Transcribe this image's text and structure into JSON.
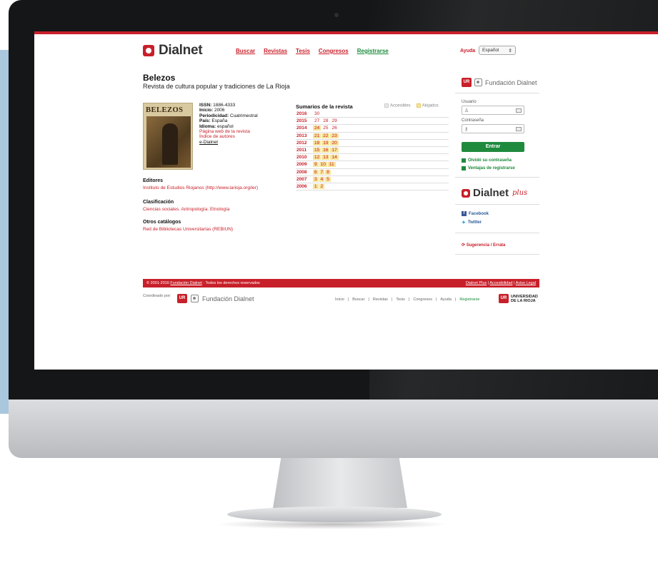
{
  "brand": {
    "name": "Dialnet",
    "accent": "#c8202a",
    "green": "#1f8a3c"
  },
  "nav": {
    "items": [
      "Buscar",
      "Revistas",
      "Tesis",
      "Congresos"
    ],
    "register": "Registrarse",
    "help": "Ayuda",
    "language": "Español"
  },
  "journal": {
    "title": "Belezos",
    "subtitle": "Revista de cultura popular y tradiciones de La Rioja",
    "cover_title": "BELEZOS",
    "issn_label": "ISSN:",
    "issn": "1886-4333",
    "inicio_label": "Inicio:",
    "inicio": "2006",
    "periodicidad_label": "Periodicidad:",
    "periodicidad": "Cuatrimestral",
    "pais_label": "País:",
    "pais": "España",
    "idioma_label": "Idioma:",
    "idioma": "español",
    "links": [
      "Página web de la revista",
      "Índice de autores",
      "e-Dialnet"
    ]
  },
  "sections": {
    "editores_title": "Editores",
    "editores": "Instituto de Estudios Riojanos (http://www.larioja.org/ier)",
    "clasificacion_title": "Clasificación",
    "clasificacion": "Ciencias sociales. Antropología. Etnología",
    "otros_title": "Otros catálogos",
    "otros": "Red de Bibliotecas Universitarias (REBIUN)"
  },
  "sumarios": {
    "title": "Sumarios de la revista",
    "legend_accesibles": "Accesibles",
    "legend_alojados": "Alojados",
    "rows": [
      {
        "year": "2016",
        "issues": [
          {
            "n": "30",
            "hosted": false
          }
        ]
      },
      {
        "year": "2015",
        "issues": [
          {
            "n": "27",
            "hosted": false
          },
          {
            "n": "28",
            "hosted": false
          },
          {
            "n": "29",
            "hosted": false
          }
        ]
      },
      {
        "year": "2014",
        "issues": [
          {
            "n": "24",
            "hosted": true
          },
          {
            "n": "25",
            "hosted": false
          },
          {
            "n": "26",
            "hosted": false
          }
        ]
      },
      {
        "year": "2013",
        "issues": [
          {
            "n": "21",
            "hosted": true
          },
          {
            "n": "22",
            "hosted": true
          },
          {
            "n": "23",
            "hosted": true
          }
        ]
      },
      {
        "year": "2012",
        "issues": [
          {
            "n": "18",
            "hosted": true
          },
          {
            "n": "19",
            "hosted": true
          },
          {
            "n": "20",
            "hosted": true
          }
        ]
      },
      {
        "year": "2011",
        "issues": [
          {
            "n": "15",
            "hosted": true
          },
          {
            "n": "16",
            "hosted": true
          },
          {
            "n": "17",
            "hosted": true
          }
        ]
      },
      {
        "year": "2010",
        "issues": [
          {
            "n": "12",
            "hosted": true
          },
          {
            "n": "13",
            "hosted": true
          },
          {
            "n": "14",
            "hosted": true
          }
        ]
      },
      {
        "year": "2009",
        "issues": [
          {
            "n": "9",
            "hosted": true
          },
          {
            "n": "10",
            "hosted": true
          },
          {
            "n": "11",
            "hosted": true
          }
        ]
      },
      {
        "year": "2008",
        "issues": [
          {
            "n": "6",
            "hosted": true
          },
          {
            "n": "7",
            "hosted": true
          },
          {
            "n": "8",
            "hosted": true
          }
        ]
      },
      {
        "year": "2007",
        "issues": [
          {
            "n": "3",
            "hosted": true
          },
          {
            "n": "4",
            "hosted": true
          },
          {
            "n": "5",
            "hosted": true
          }
        ]
      },
      {
        "year": "2006",
        "issues": [
          {
            "n": "1",
            "hosted": true
          },
          {
            "n": "2",
            "hosted": true
          }
        ]
      }
    ]
  },
  "sidebar": {
    "fundacion": "Fundación Dialnet",
    "usuario_label": "Usuario",
    "password_label": "Contraseña",
    "login_button": "Entrar",
    "forgot": "Olvidó su contraseña",
    "benefits": "Ventajas de registrarse",
    "plus_name": "Dialnet",
    "plus_word": "plus",
    "facebook": "Facebook",
    "twitter": "Twitter",
    "suggestion": "Sugerencia / Errata"
  },
  "footer": {
    "copyright_pre": "© 2001-2016",
    "copyright_link": "Fundación Dialnet",
    "copyright_post": "· Todos los derechos reservados",
    "links": [
      "Dialnet Plus",
      "Accesibilidad",
      "Aviso Legal"
    ],
    "coordinated_by": "Coordinado por:",
    "fundacion": "Fundación Dialnet",
    "nav": [
      "Inicio",
      "Buscar",
      "Revistas",
      "Tesis",
      "Congresos",
      "Ayuda"
    ],
    "register": "Registrarse",
    "university_line1": "UNIVERSIDAD",
    "university_line2": "DE LA RIOJA"
  }
}
